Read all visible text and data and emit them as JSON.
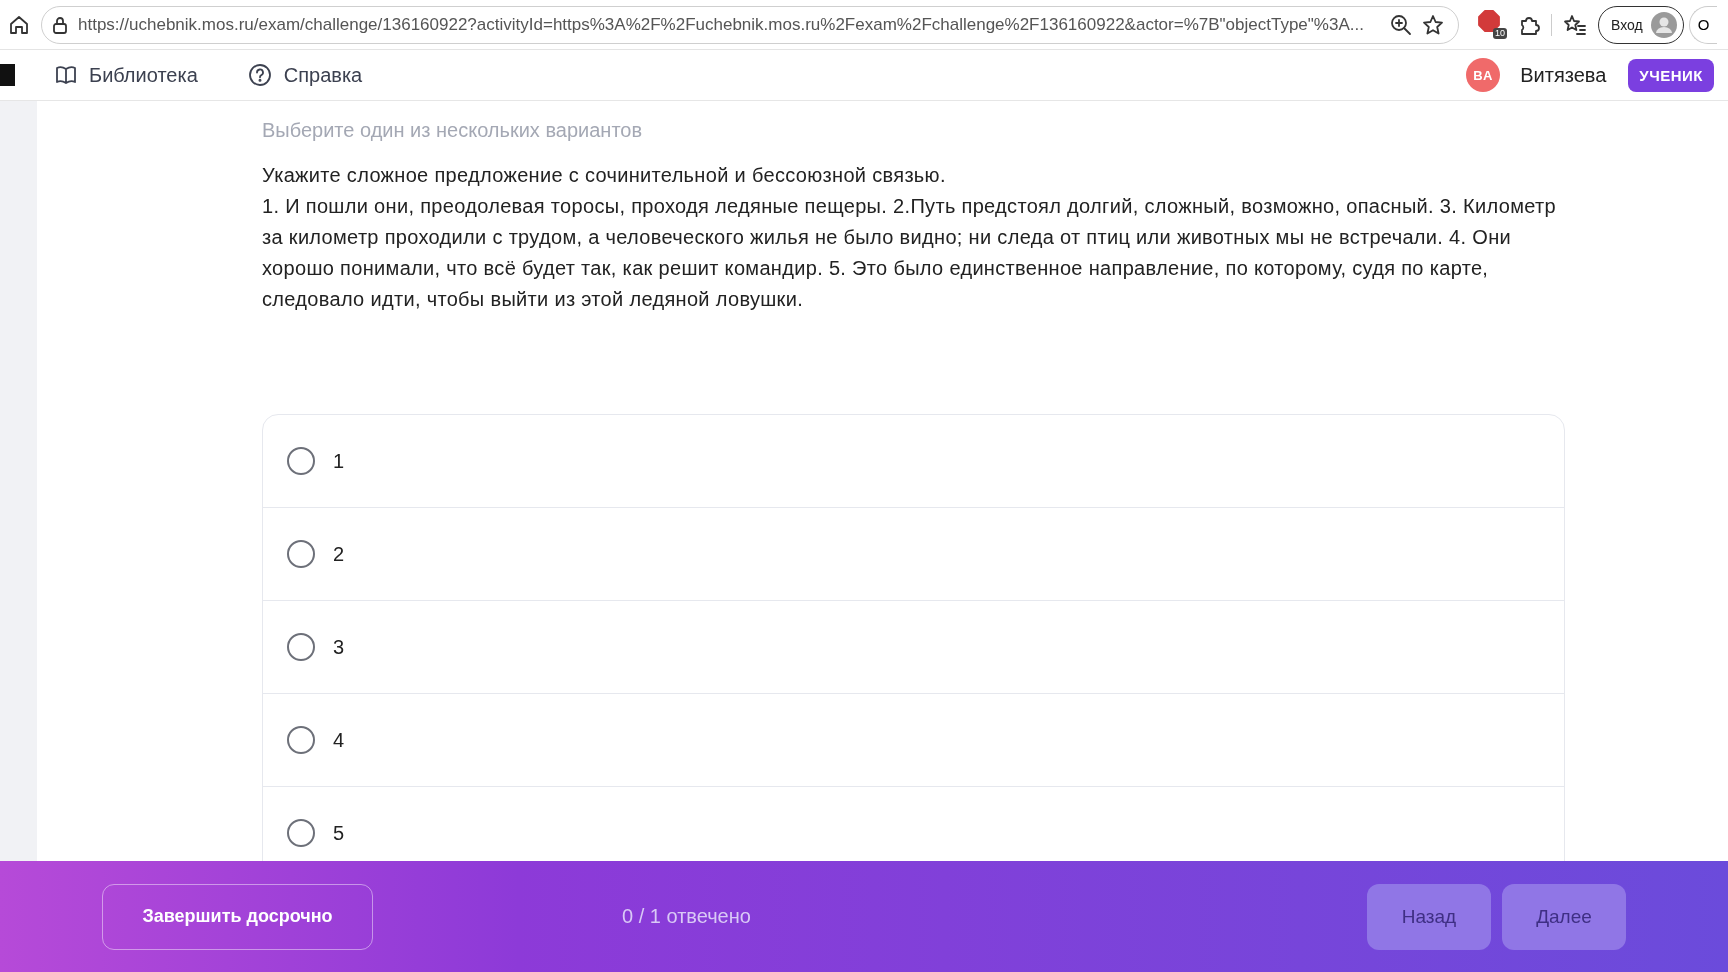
{
  "browser": {
    "url": "https://uchebnik.mos.ru/exam/challenge/136160922?activityId=https%3A%2F%2Fuchebnik.mos.ru%2Fexam%2Fchallenge%2F136160922&actor=%7B\"objectType\"%3A...",
    "extension_badge": "10",
    "sign_in": "Вход",
    "edge_button": "О"
  },
  "header": {
    "nav": [
      {
        "label": "Библиотека"
      },
      {
        "label": "Справка"
      }
    ],
    "user": {
      "initials": "ВА",
      "name": "Витязева",
      "role": "УЧЕНИК"
    }
  },
  "question": {
    "hint": "Выберите один из нескольких вариантов",
    "text": [
      "Укажите сложное предложение с сочинительной и бессоюзной связью.",
      "1. И пошли они, преодолевая торосы, проходя ледяные пещеры. 2.Путь предстоял долгий, сложный, возможно, опасный. 3. Километр за километр проходили с трудом, а человеческого жилья не было видно; ни следа от птиц или  животных мы не встречали. 4. Они хорошо понимали, что всё будет так, как решит командир. 5.  Это было единственное направление, по которому, судя по карте, следовало идти, чтобы выйти из этой ледяной ловушки."
    ],
    "options": [
      {
        "label": "1",
        "selected": false
      },
      {
        "label": "2",
        "selected": false
      },
      {
        "label": "3",
        "selected": false
      },
      {
        "label": "4",
        "selected": false
      },
      {
        "label": "5",
        "selected": false
      }
    ]
  },
  "footer": {
    "finish": "Завершить досрочно",
    "progress": "0 / 1 отвечено",
    "back": "Назад",
    "next": "Далее"
  }
}
